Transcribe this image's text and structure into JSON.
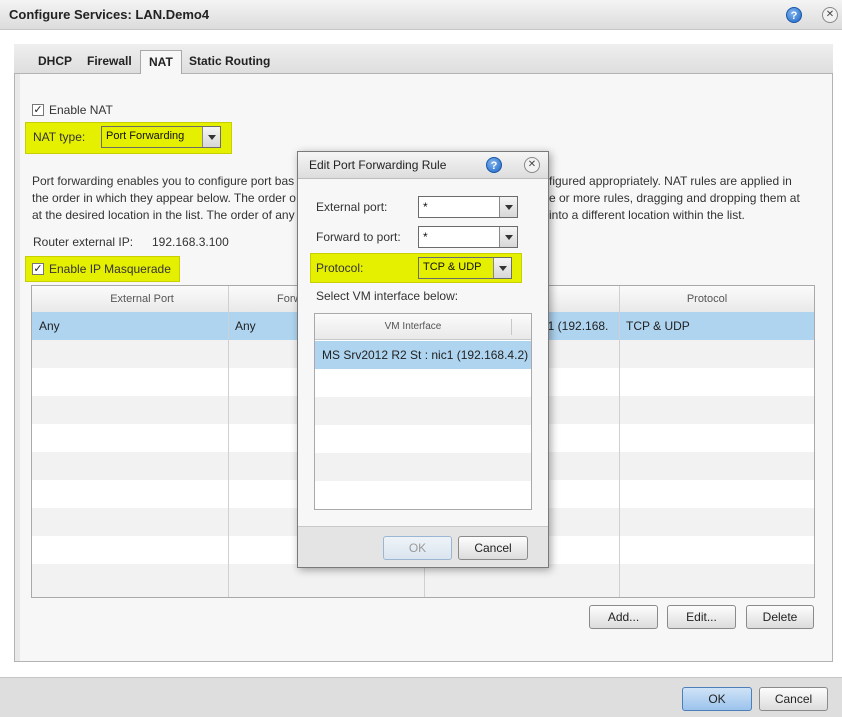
{
  "window": {
    "title": "Configure Services: LAN.Demo4",
    "help_icon": "?",
    "close_icon": "✕"
  },
  "tabs": [
    "DHCP",
    "Firewall",
    "NAT",
    "Static Routing"
  ],
  "active_tab": "NAT",
  "nat": {
    "enable_nat_label": "Enable NAT",
    "enable_nat_checked": true,
    "nat_type_label": "NAT type:",
    "nat_type_value": "Port Forwarding",
    "description_line1_left": "Port forwarding enables you to configure port bas",
    "description_line1_right": "figured appropriately. NAT rules are applied in",
    "description_line2_left": "the order in which they appear below. The order o",
    "description_line2_right": "e or more rules, dragging and dropping them at",
    "description_line3_left": "at the desired location in the list. The order of any s",
    "description_line3_right": "into a different location within the list.",
    "router_ip_label": "Router external IP:",
    "router_ip_value": "192.168.3.100",
    "masquerade_label": "Enable IP Masquerade",
    "masquerade_checked": true
  },
  "rules_table": {
    "headers": {
      "external_port": "External Port",
      "forward_port": "Forw",
      "protocol": "Protocol"
    },
    "rows": [
      {
        "external_port": "Any",
        "forward_port": "Any",
        "vm_interface_partial": "ic1 (192.168.",
        "protocol": "TCP & UDP"
      }
    ]
  },
  "table_buttons": {
    "add": "Add...",
    "edit": "Edit...",
    "delete": "Delete"
  },
  "footer_buttons": {
    "ok": "OK",
    "cancel": "Cancel"
  },
  "dialog": {
    "title": "Edit Port Forwarding Rule",
    "help_icon": "?",
    "close_icon": "✕",
    "external_port_label": "External port:",
    "external_port_value": "*",
    "forward_port_label": "Forward to port:",
    "forward_port_value": "*",
    "protocol_label": "Protocol:",
    "protocol_value": "TCP & UDP",
    "select_vm_label": "Select VM interface below:",
    "vm_interface_header": "VM Interface",
    "vm_interfaces": [
      "MS Srv2012 R2 St : nic1 (192.168.4.2)"
    ],
    "ok": "OK",
    "cancel": "Cancel"
  },
  "colors": {
    "highlight": "#e5ef00",
    "selection": "#aed4f0",
    "primary_button": "#9cc3ec"
  }
}
